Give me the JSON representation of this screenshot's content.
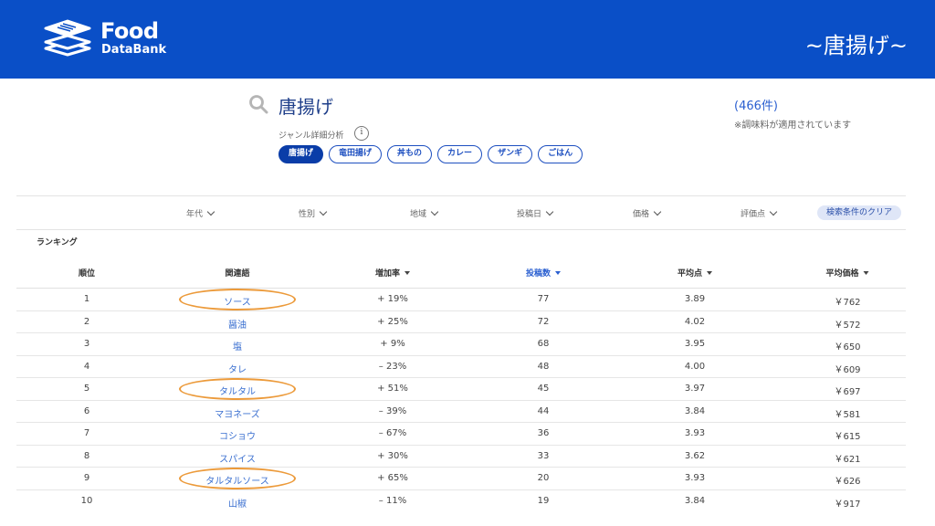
{
  "header": {
    "logo_line1": "Food",
    "logo_line2": "DataBank",
    "title": "~唐揚げ~",
    "bg_color": "#0a4fc7"
  },
  "search": {
    "icon": "search-icon",
    "query": "唐揚げ",
    "result_count": "(466件)",
    "note": "※調味料が適用されています"
  },
  "genre": {
    "label": "ジャンル詳細分析",
    "info_icon": "info-icon",
    "chips": [
      {
        "label": "唐揚げ",
        "active": true
      },
      {
        "label": "竜田揚げ",
        "active": false
      },
      {
        "label": "丼もの",
        "active": false
      },
      {
        "label": "カレー",
        "active": false
      },
      {
        "label": "ザンギ",
        "active": false
      },
      {
        "label": "ごはん",
        "active": false
      }
    ]
  },
  "filters": {
    "items": [
      "年代",
      "性別",
      "地域",
      "投稿日",
      "価格",
      "評価点"
    ],
    "clear_label": "検索条件のクリア"
  },
  "ranking": {
    "label": "ランキング",
    "headers": {
      "rank": "順位",
      "term": "関連語",
      "growth": "増加率",
      "posts": "投稿数",
      "avg_score": "平均点",
      "avg_price": "平均価格"
    },
    "rows": [
      {
        "rank": "1",
        "term": "ソース",
        "growth": "+ 19%",
        "posts": "77",
        "avg_score": "3.89",
        "avg_price": "￥762",
        "highlighted": true
      },
      {
        "rank": "2",
        "term": "醤油",
        "growth": "+ 25%",
        "posts": "72",
        "avg_score": "4.02",
        "avg_price": "￥572",
        "highlighted": false
      },
      {
        "rank": "3",
        "term": "塩",
        "growth": "+ 9%",
        "posts": "68",
        "avg_score": "3.95",
        "avg_price": "￥650",
        "highlighted": false
      },
      {
        "rank": "4",
        "term": "タレ",
        "growth": "– 23%",
        "posts": "48",
        "avg_score": "4.00",
        "avg_price": "￥609",
        "highlighted": false
      },
      {
        "rank": "5",
        "term": "タルタル",
        "growth": "+ 51%",
        "posts": "45",
        "avg_score": "3.97",
        "avg_price": "￥697",
        "highlighted": true
      },
      {
        "rank": "6",
        "term": "マヨネーズ",
        "growth": "– 39%",
        "posts": "44",
        "avg_score": "3.84",
        "avg_price": "￥581",
        "highlighted": false
      },
      {
        "rank": "7",
        "term": "コショウ",
        "growth": "– 67%",
        "posts": "36",
        "avg_score": "3.93",
        "avg_price": "￥615",
        "highlighted": false
      },
      {
        "rank": "8",
        "term": "スパイス",
        "growth": "+ 30%",
        "posts": "33",
        "avg_score": "3.62",
        "avg_price": "￥621",
        "highlighted": false
      },
      {
        "rank": "9",
        "term": "タルタルソース",
        "growth": "+ 65%",
        "posts": "20",
        "avg_score": "3.93",
        "avg_price": "￥626",
        "highlighted": true
      },
      {
        "rank": "10",
        "term": "山椒",
        "growth": "– 11%",
        "posts": "19",
        "avg_score": "3.84",
        "avg_price": "￥917",
        "highlighted": false
      }
    ]
  }
}
